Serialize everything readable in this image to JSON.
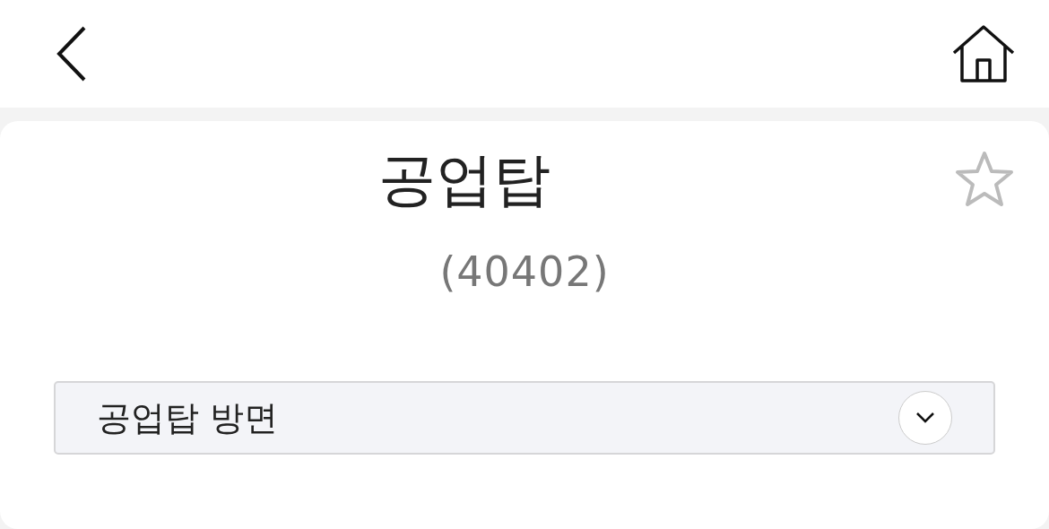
{
  "station": {
    "name": "공업탑",
    "code": "(40402)",
    "starred": false
  },
  "direction_select": {
    "value": "공업탑 방면",
    "expanded": false
  }
}
